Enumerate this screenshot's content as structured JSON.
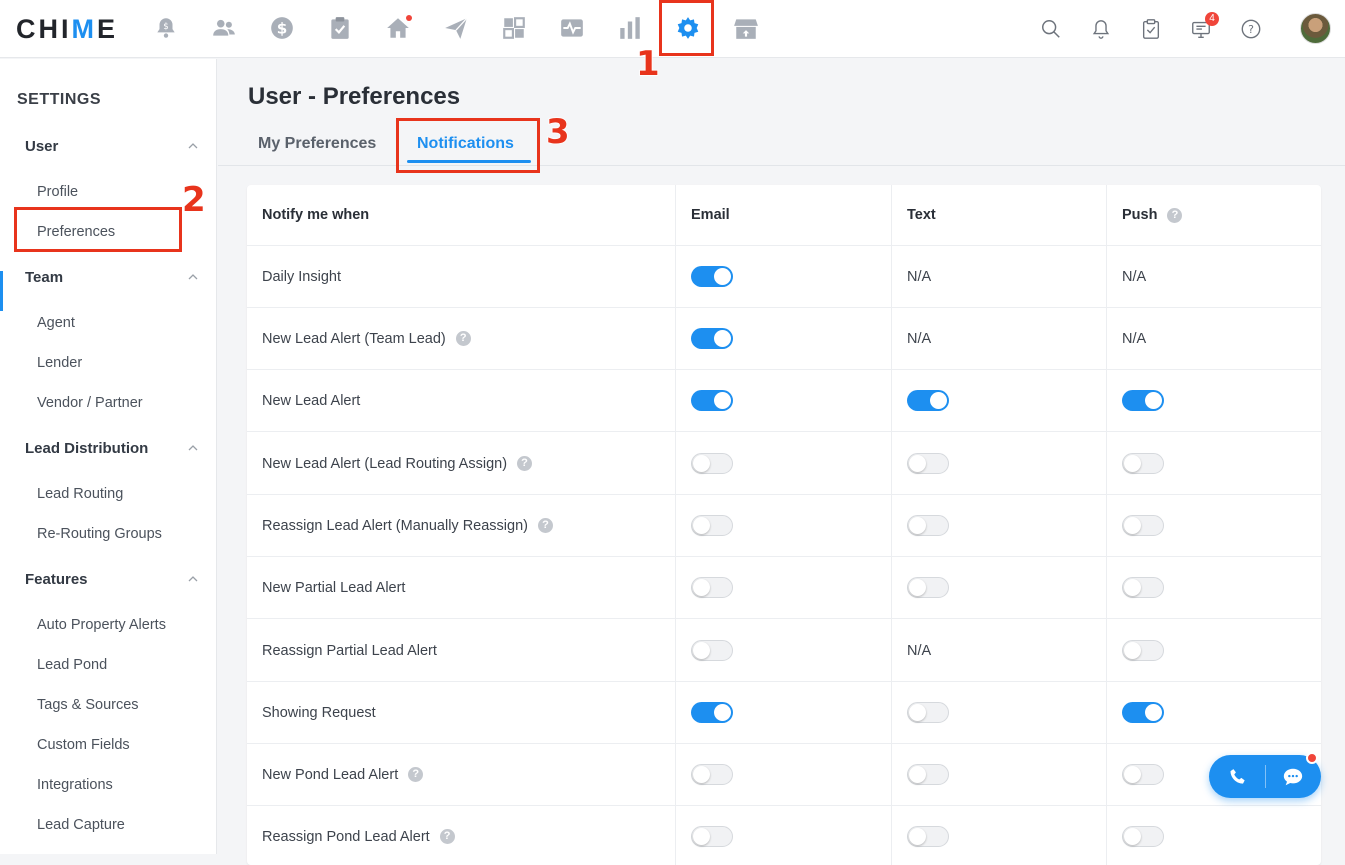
{
  "app": {
    "logo_prefix": "CHI",
    "logo_accent": "M",
    "logo_suffix": "E"
  },
  "topnav": {
    "icons": [
      "alerts-icon",
      "people-icon",
      "dollar-icon",
      "clipboard-icon",
      "home-icon",
      "send-icon",
      "dashboard-icon",
      "pulse-icon",
      "bar-chart-icon",
      "settings-gear-icon",
      "store-icon"
    ],
    "active": "settings-gear-icon"
  },
  "header_right": {
    "icons": [
      "search-icon",
      "bell-icon",
      "checklist-icon",
      "monitor-icon",
      "help-icon"
    ],
    "monitor_badge": "4"
  },
  "annotations": {
    "one": "1",
    "two": "2",
    "three": "3"
  },
  "sidebar": {
    "title": "SETTINGS",
    "sections": [
      {
        "label": "User",
        "items": [
          "Profile",
          "Preferences"
        ]
      },
      {
        "label": "Team",
        "items": [
          "Agent",
          "Lender",
          "Vendor / Partner"
        ]
      },
      {
        "label": "Lead Distribution",
        "items": [
          "Lead Routing",
          "Re-Routing Groups"
        ]
      },
      {
        "label": "Features",
        "items": [
          "Auto Property Alerts",
          "Lead Pond",
          "Tags & Sources",
          "Custom Fields",
          "Integrations",
          "Lead Capture"
        ]
      }
    ],
    "active_item": "Preferences"
  },
  "main": {
    "title": "User - Preferences",
    "tabs": [
      "My Preferences",
      "Notifications"
    ],
    "active_tab": "Notifications"
  },
  "table": {
    "headers": [
      "Notify me when",
      "Email",
      "Text",
      "Push"
    ],
    "help_glyph": "?",
    "rows": [
      {
        "label": "Daily Insight",
        "help": false,
        "email": "on",
        "text": "N/A",
        "push": "N/A"
      },
      {
        "label": "New Lead Alert (Team Lead)",
        "help": true,
        "email": "on",
        "text": "N/A",
        "push": "N/A"
      },
      {
        "label": "New Lead Alert",
        "help": false,
        "email": "on",
        "text": "on",
        "push": "on"
      },
      {
        "label": "New Lead Alert (Lead Routing Assign)",
        "help": true,
        "email": "off",
        "text": "off",
        "push": "off"
      },
      {
        "label": "Reassign Lead Alert (Manually Reassign)",
        "help": true,
        "email": "off",
        "text": "off",
        "push": "off"
      },
      {
        "label": "New Partial Lead Alert",
        "help": false,
        "email": "off",
        "text": "off",
        "push": "off"
      },
      {
        "label": "Reassign Partial Lead Alert",
        "help": false,
        "email": "off",
        "text": "N/A",
        "push": "off"
      },
      {
        "label": "Showing Request",
        "help": false,
        "email": "on",
        "text": "off",
        "push": "on"
      },
      {
        "label": "New Pond Lead Alert",
        "help": true,
        "email": "off",
        "text": "off",
        "push": "off"
      },
      {
        "label": "Reassign Pond Lead Alert",
        "help": true,
        "email": "off",
        "text": "off",
        "push": "off"
      }
    ]
  },
  "colors": {
    "accent": "#1d8ff0",
    "annotation": "#e8341c",
    "badge": "#f0453a"
  }
}
